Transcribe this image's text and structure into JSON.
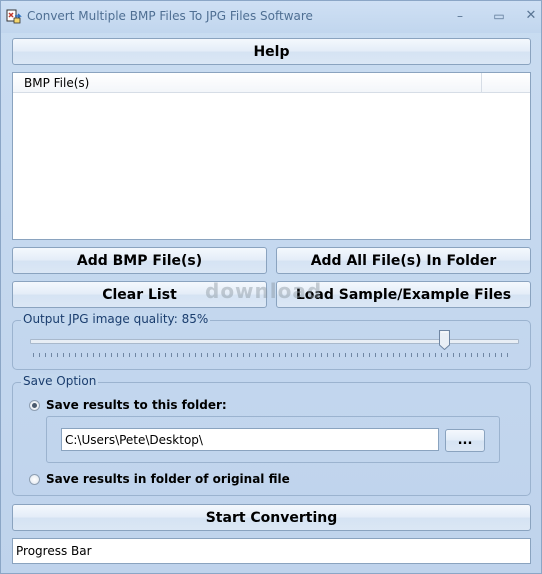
{
  "window": {
    "title": "Convert Multiple BMP Files To JPG Files Software",
    "controls": {
      "minimize": "–",
      "maximize": "▭",
      "close": "✕"
    },
    "app_icon": "bmp-jpg-app-icon"
  },
  "buttons": {
    "help": "Help",
    "add_files": "Add BMP File(s)",
    "add_folder": "Add All File(s) In Folder",
    "clear_list": "Clear List",
    "load_sample": "Load Sample/Example Files",
    "start": "Start Converting",
    "browse": "..."
  },
  "file_list": {
    "column_header": "BMP File(s)",
    "rows": []
  },
  "watermark": "download",
  "quality": {
    "label": "Output JPG image quality: 85%",
    "value": 85
  },
  "save_option": {
    "legend": "Save Option",
    "option_folder": "Save results to this folder:",
    "folder_path": "C:\\Users\\Pete\\Desktop\\",
    "option_original": "Save results in folder of original file",
    "selected": "folder"
  },
  "progress": {
    "label": "Progress Bar",
    "value": 0
  },
  "colors": {
    "window_bg": "#c3d8ef",
    "legend_text": "#1a3d6e",
    "progress_fill": "#7fb2e5"
  }
}
